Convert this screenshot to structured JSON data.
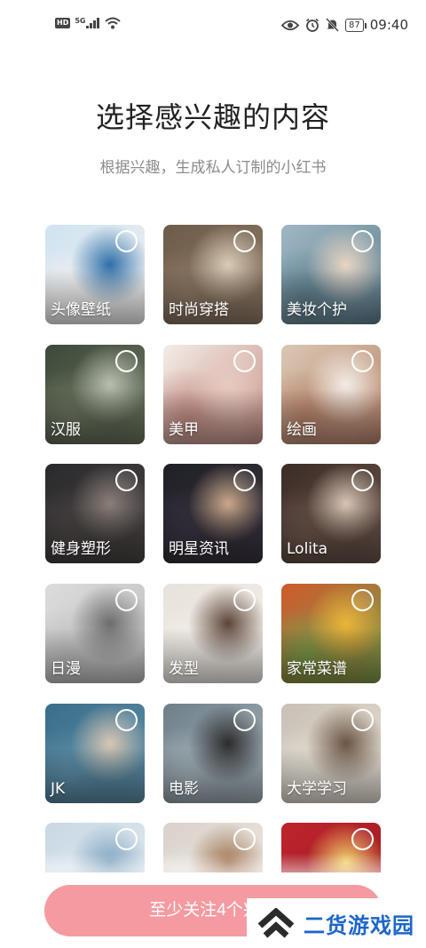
{
  "status_bar": {
    "hd_badge": "HD",
    "network": "5G",
    "battery": "87",
    "time": "09:40"
  },
  "title": "选择感兴趣的内容",
  "subtitle": "根据兴趣，生成私人订制的小红书",
  "categories": [
    {
      "label": "头像壁纸",
      "colors": [
        "#cfe3f2",
        "#2e6fa8",
        "#f3f0ee"
      ]
    },
    {
      "label": "时尚穿搭",
      "colors": [
        "#6d5c4a",
        "#d9cbb8",
        "#8f7a66"
      ]
    },
    {
      "label": "美妆个护",
      "colors": [
        "#9fb7c4",
        "#e8d4c2",
        "#5f7f8e"
      ]
    },
    {
      "label": "汉服",
      "colors": [
        "#3d4a3a",
        "#b9bfb0",
        "#6c7560"
      ]
    },
    {
      "label": "美甲",
      "colors": [
        "#f3ede7",
        "#e6c9bf",
        "#c48d84"
      ]
    },
    {
      "label": "绘画",
      "colors": [
        "#d9c8b4",
        "#f2ece6",
        "#b8836a"
      ]
    },
    {
      "label": "健身塑形",
      "colors": [
        "#2a2a2c",
        "#8a7f78",
        "#4a4444"
      ]
    },
    {
      "label": "明星资讯",
      "colors": [
        "#1f2026",
        "#caa88a",
        "#3a3340"
      ]
    },
    {
      "label": "Lolita",
      "colors": [
        "#3b2c26",
        "#d7c4b4",
        "#6a554b"
      ]
    },
    {
      "label": "日漫",
      "colors": [
        "#dcdcdc",
        "#6c6c6c",
        "#bdbdbd"
      ]
    },
    {
      "label": "发型",
      "colors": [
        "#e8e2dc",
        "#5c4438",
        "#f4efe9"
      ]
    },
    {
      "label": "家常菜谱",
      "colors": [
        "#cf5a2c",
        "#e9b63a",
        "#7a9c4a"
      ]
    },
    {
      "label": "JK",
      "colors": [
        "#3a6e8a",
        "#d8c7b2",
        "#5f8fa8"
      ]
    },
    {
      "label": "电影",
      "colors": [
        "#6f7f8a",
        "#2c2c2c",
        "#a5b3ba"
      ]
    },
    {
      "label": "大学学习",
      "colors": [
        "#c8c0b4",
        "#6b5442",
        "#e6e0d6"
      ]
    },
    {
      "label": "",
      "colors": [
        "#c9d8e3",
        "#7fa4bf",
        "#e2ecf3"
      ]
    },
    {
      "label": "",
      "colors": [
        "#d8d2ca",
        "#a07450",
        "#efe9e3"
      ]
    },
    {
      "label": "",
      "colors": [
        "#c0242c",
        "#f1d36a",
        "#9b1b22"
      ]
    }
  ],
  "cta": {
    "label": "至少关注4个兴趣",
    "color": "#f59aa1"
  },
  "watermark": {
    "text": "二货游戏园",
    "color": "#1d67c9"
  }
}
